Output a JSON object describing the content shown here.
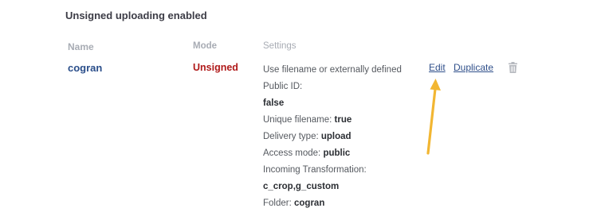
{
  "section": {
    "title": "Unsigned uploading enabled"
  },
  "table": {
    "headers": {
      "name": "Name",
      "mode": "Mode",
      "settings": "Settings"
    },
    "row": {
      "name": "cogran",
      "mode": "Unsigned",
      "settings": {
        "public_id_label": "Use filename or externally defined",
        "public_id_label2": "Public ID:",
        "public_id_value": "false",
        "unique_label": "Unique filename:",
        "unique_value": "true",
        "delivery_label": "Delivery type:",
        "delivery_value": "upload",
        "access_label": "Access mode:",
        "access_value": "public",
        "incoming_label": "Incoming Transformation:",
        "incoming_value": "c_crop,g_custom",
        "folder_label": "Folder:",
        "folder_value": "cogran"
      },
      "actions": {
        "edit": "Edit",
        "duplicate": "Duplicate",
        "delete_icon": "trash-icon"
      }
    }
  },
  "colors": {
    "name_link": "#2a4e8a",
    "mode_unsigned": "#b01a1a",
    "arrow": "#f2b632"
  }
}
